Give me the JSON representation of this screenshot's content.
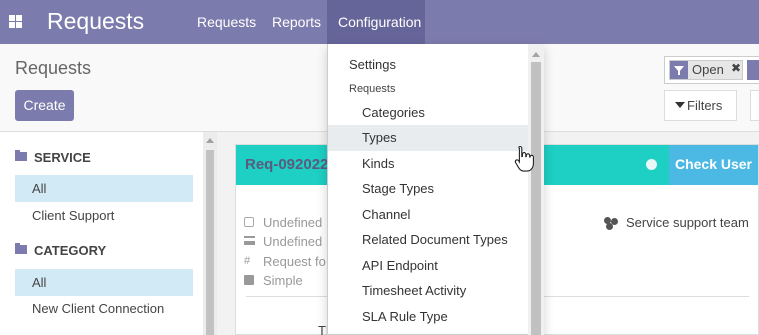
{
  "navbar": {
    "app_title": "Requests",
    "menu": [
      "Requests",
      "Reports",
      "Configuration"
    ]
  },
  "control_panel": {
    "breadcrumb": "Requests",
    "create_label": "Create",
    "facet_label": "Open",
    "facet_remove": "✖",
    "filters_label": "Filters"
  },
  "search_panel": {
    "sections": [
      {
        "header": "SERVICE",
        "items": [
          "All",
          "Client Support"
        ],
        "active": "All"
      },
      {
        "header": "CATEGORY",
        "items": [
          "All",
          "New Client Connection"
        ],
        "active": "All"
      }
    ]
  },
  "card": {
    "reference": "Req-092022",
    "action_label": "Check User",
    "fields": [
      "Undefined",
      "Undefined",
      "Request fo",
      "Simple"
    ],
    "team": "Service support team",
    "bottom_text": "Th"
  },
  "dropdown": {
    "settings": "Settings",
    "section_header": "Requests",
    "items": [
      "Categories",
      "Types",
      "Kinds",
      "Stage Types",
      "Channel",
      "Related Document Types",
      "API Endpoint",
      "Timesheet Activity",
      "SLA Rule Type"
    ],
    "hovered": "Types"
  },
  "colors": {
    "brand": "#7c7bad",
    "card_header": "#1ecfc4",
    "check_user": "#4cb9e4",
    "active_item": "#d2e9f6"
  }
}
